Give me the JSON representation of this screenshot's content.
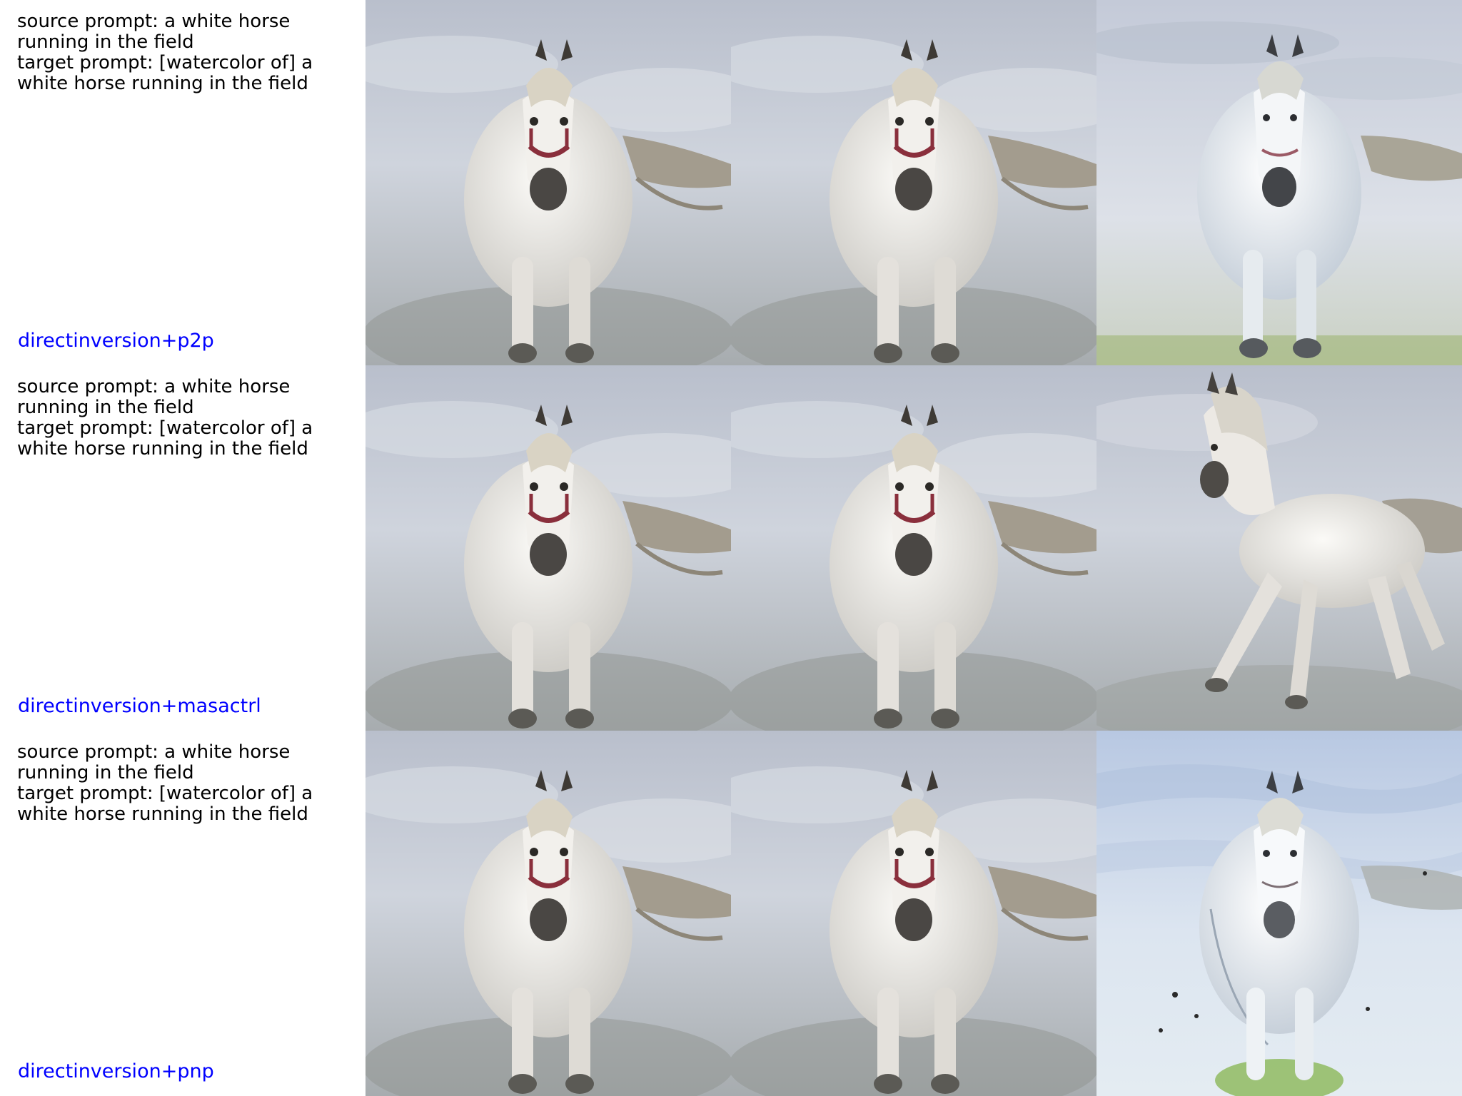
{
  "rows": [
    {
      "source_prompt": "source prompt: a white horse running in the field",
      "target_prompt": "target prompt: [watercolor of] a white horse running in the field",
      "method": "directinversion+p2p"
    },
    {
      "source_prompt": "source prompt: a white horse running in the field",
      "target_prompt": "target prompt: [watercolor of] a white horse running in the field",
      "method": "directinversion+masactrl"
    },
    {
      "source_prompt": "source prompt: a white horse running in the field",
      "target_prompt": "target prompt: [watercolor of] a white horse running in the field",
      "method": "directinversion+pnp"
    }
  ],
  "colors": {
    "method_label": "#0000ff",
    "prompt_text": "#000000",
    "sky": "#c9ced8",
    "horse": "#eceae6",
    "bridle": "#8a2f3c",
    "grass": "#7fa04a"
  },
  "images": [
    [
      "horse-photo-front",
      "horse-photo-front",
      "horse-watercolor-front"
    ],
    [
      "horse-photo-front",
      "horse-photo-front",
      "horse-photo-galloping"
    ],
    [
      "horse-photo-front",
      "horse-photo-front",
      "horse-watercolor-front-light"
    ]
  ]
}
